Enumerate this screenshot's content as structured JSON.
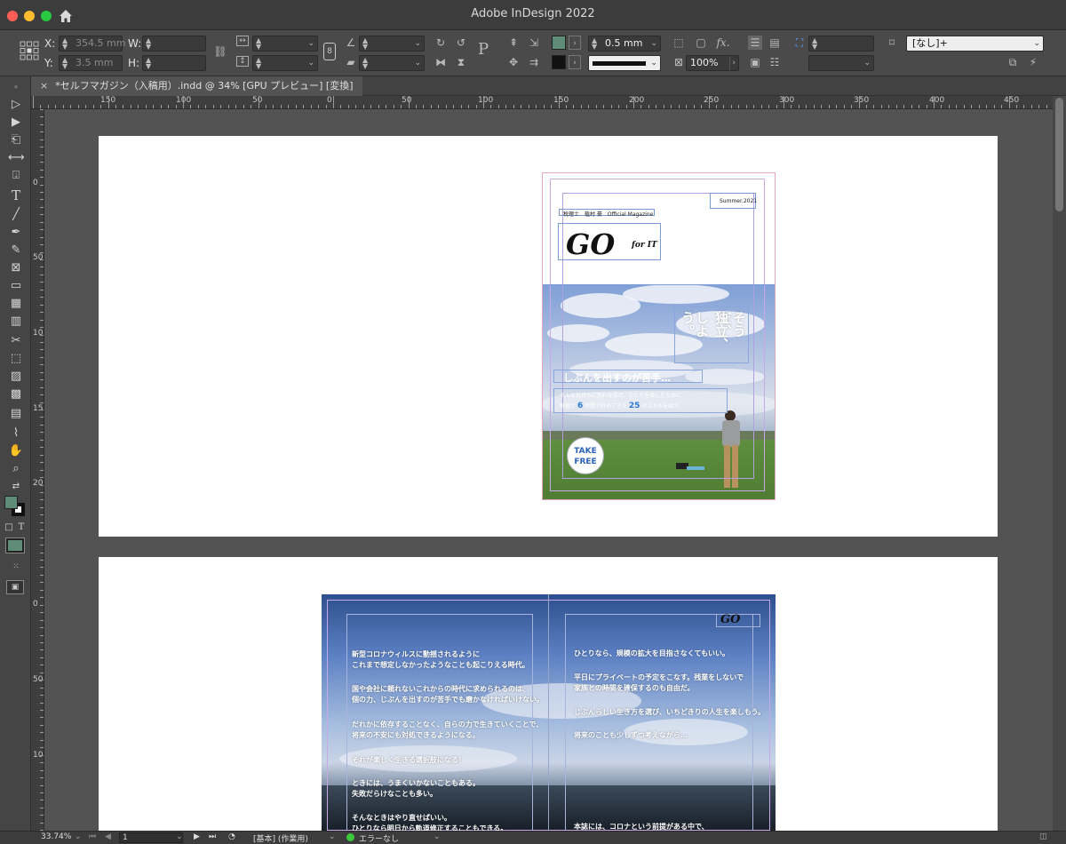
{
  "app": {
    "title": "Adobe InDesign 2022"
  },
  "control": {
    "x_label": "X:",
    "y_label": "Y:",
    "w_label": "W:",
    "h_label": "H:",
    "x_value": "354.5 mm",
    "y_value": "3.5 mm",
    "stroke_weight": "0.5 mm",
    "opacity": "100%",
    "object_style": "[なし]+",
    "fill_color": "#5e8c78",
    "stroke_color": "#111111"
  },
  "document": {
    "tab": "*セルフマガジン（入稿用）.indd @ 34% [GPU プレビュー] [変換]"
  },
  "ruler": {
    "h_ticks": [
      "150",
      "100",
      "50",
      "0",
      "50",
      "100",
      "150",
      "200",
      "250",
      "300",
      "350",
      "400",
      "450"
    ],
    "v_ticks": [
      "0",
      "50",
      "100",
      "150",
      "200",
      "0",
      "50",
      "100"
    ]
  },
  "page1": {
    "date": "Summer.2021",
    "author": "税理士　植村 豪　Official Magazine",
    "logo": "GO",
    "logo_sub": "for IT",
    "vertical_a": "そうだ、",
    "vertical_b": "独立、",
    "vertical_c": "しよう。",
    "headline": "しぶんを出すのが苦手…",
    "sub1": "そんな気持ちに別れを告げ、ひとりを楽しむために",
    "sub2_a": "税理士",
    "sub2_num1": "6",
    "sub2_b": "年間で貯めてきた",
    "sub2_num2": "25",
    "sub2_c": "のスキルを紹介",
    "badge_1": "TAKE",
    "badge_2": "FREE"
  },
  "page2": {
    "logo": "GO",
    "left": [
      "新型コロナウィルスに動揺されるように",
      "これまで想定しなかったようなことも起こりえる時代。",
      "国や会社に頼れないこれからの時代に求められるのは、",
      "個の力、じぶんを出すのが苦手でも磨かなければいけない。",
      "だれかに依存することなく、自らの力で生きていくことで、",
      "将来の不安にも対処できるようになる。",
      "それが楽しく生きる選択肢になる！",
      "ときには、うまくいかないこともある。",
      "失敗だらけなことも多い。",
      "そんなときはやり直せばいい。",
      "ひとりなら明日から軌道修正することもできる。"
    ],
    "right": [
      "ひとりなら、規模の拡大を目指さなくてもいい。",
      "平日にプライベートの予定をこなす。残業をしないで",
      "家族との時間を確保するのも自由だ。",
      "じぶんらしい生き方を選び、いちどきりの人生を楽しもう。",
      "将来のことも少しずつ考えながら…",
      "本誌には、コロナという前提がある中で、"
    ]
  },
  "status": {
    "zoom": "33.74%",
    "page": "1",
    "profile": "[基本] (作業用)",
    "preflight": "エラーなし"
  }
}
